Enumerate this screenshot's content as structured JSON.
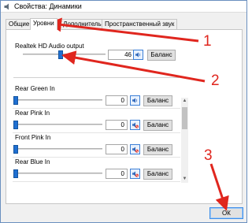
{
  "window": {
    "title": "Свойства: Динамики",
    "title_icon": "speaker-icon"
  },
  "tabs": [
    {
      "label": "Общие",
      "active": false
    },
    {
      "label": "Уровни",
      "active": true
    },
    {
      "label": "Дополнительно",
      "active": false
    },
    {
      "label": "Пространственный звук",
      "active": false
    }
  ],
  "output": {
    "name": "Realtek HD Audio output",
    "value": "46",
    "level_percent": 46,
    "balance_label": "Баланс"
  },
  "inputs": [
    {
      "name": "Rear Green In",
      "value": "0",
      "muted": false,
      "balance_label": "Баланс"
    },
    {
      "name": "Rear Pink In",
      "value": "0",
      "muted": true,
      "balance_label": "Баланс"
    },
    {
      "name": "Front Pink In",
      "value": "0",
      "muted": true,
      "balance_label": "Баланс"
    },
    {
      "name": "Rear Blue In",
      "value": "0",
      "muted": true,
      "balance_label": "Баланс"
    }
  ],
  "footer": {
    "ok_label": "ОК"
  },
  "annotations": {
    "color": "#e0261e",
    "step1": "1",
    "step2": "2",
    "step3": "3"
  }
}
